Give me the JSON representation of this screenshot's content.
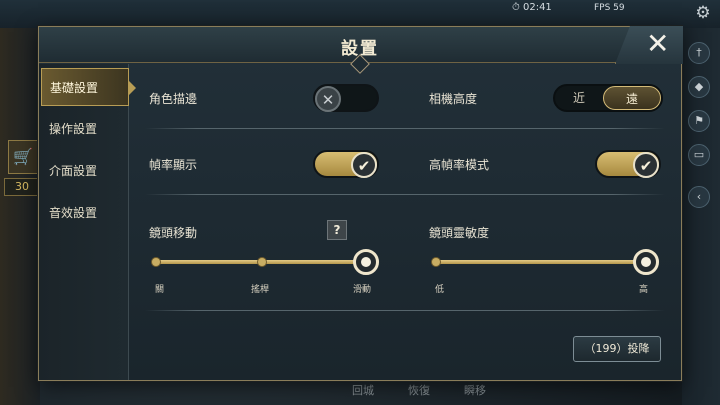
{
  "hud": {
    "time": "⏱ 02:41",
    "fps": "FPS 59",
    "bottom_items": [
      "回城",
      "恢復",
      "瞬移"
    ],
    "left_counter": "30"
  },
  "dialog": {
    "title": "設置",
    "close_symbol": "✕"
  },
  "sidebar": {
    "items": [
      {
        "label": "基礎設置",
        "active": true
      },
      {
        "label": "操作設置",
        "active": false
      },
      {
        "label": "介面設置",
        "active": false
      },
      {
        "label": "音效設置",
        "active": false
      }
    ]
  },
  "settings": {
    "outline": {
      "label": "角色描邊",
      "state": "off"
    },
    "camera_height": {
      "label": "相機高度",
      "options": [
        "近",
        "遠"
      ],
      "selected": "遠"
    },
    "framerate_display": {
      "label": "幀率顯示",
      "state": "on"
    },
    "high_framerate": {
      "label": "高幀率模式",
      "state": "on"
    },
    "camera_move": {
      "label": "鏡頭移動",
      "help_symbol": "?",
      "ticks": [
        "關",
        "搖桿",
        "滑動"
      ],
      "selected": "滑動"
    },
    "camera_sensitivity": {
      "label": "鏡頭靈敏度",
      "min_label": "低",
      "max_label": "高",
      "value_fraction": 1.0
    }
  },
  "surrender_button": {
    "label": "（199）投降"
  },
  "colors": {
    "accent_gold": "#c8ad63",
    "panel_bg": "#1f2b33",
    "text": "#e9e4d4"
  }
}
